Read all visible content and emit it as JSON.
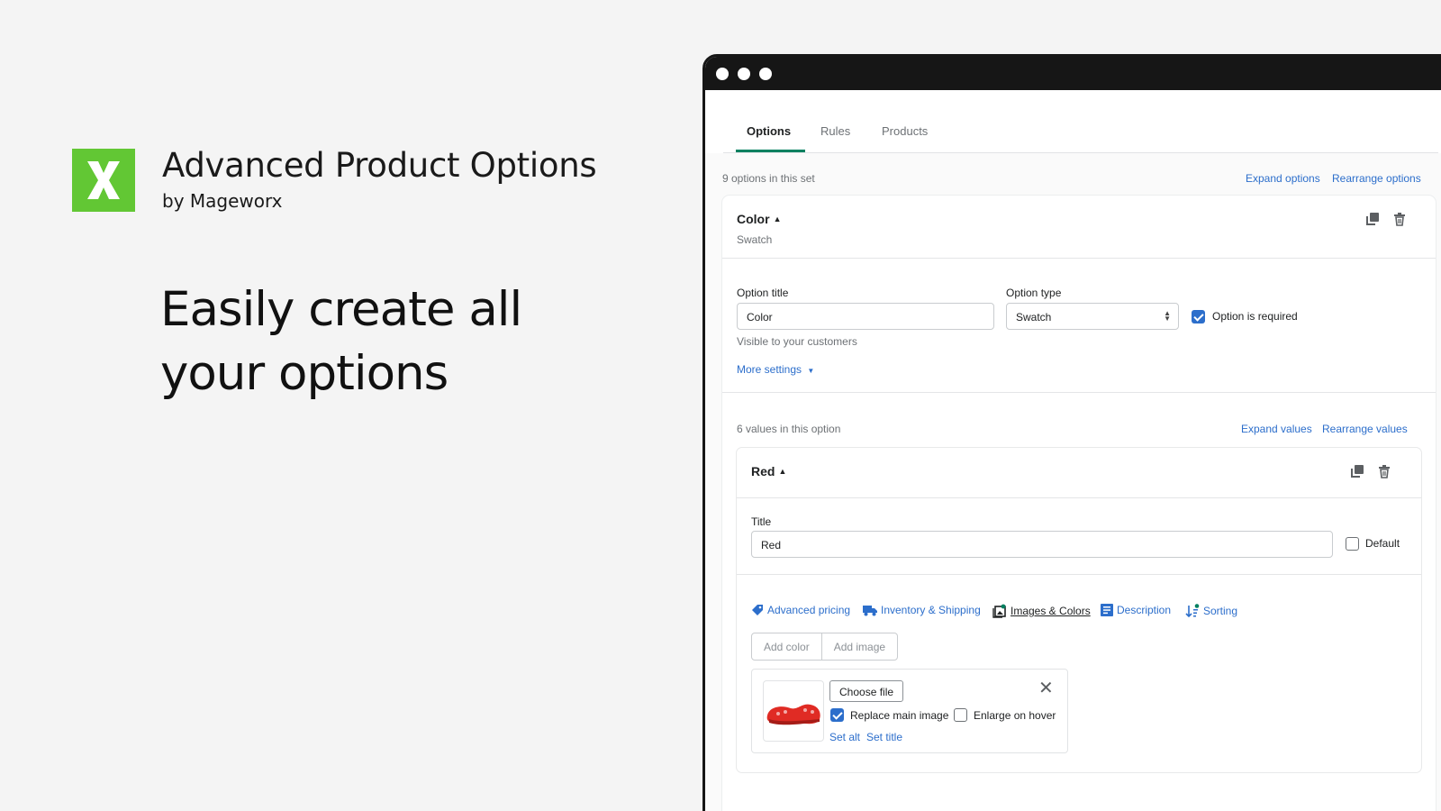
{
  "brand": {
    "title": "Advanced Product Options",
    "by": "by Mageworx",
    "headline": "Easily create all your options",
    "logo_color": "#62c734"
  },
  "tabs": [
    {
      "label": "Options",
      "active": true
    },
    {
      "label": "Rules",
      "active": false
    },
    {
      "label": "Products",
      "active": false
    }
  ],
  "options_meta": {
    "count_text": "9 options in this set",
    "expand": "Expand options",
    "rearrange": "Rearrange options"
  },
  "option": {
    "name": "Color",
    "subtitle": "Swatch",
    "title_label": "Option title",
    "title_value": "Color",
    "title_help": "Visible to your customers",
    "type_label": "Option type",
    "type_value": "Swatch",
    "required_label": "Option is required",
    "required": true,
    "more_settings": "More settings"
  },
  "values_meta": {
    "count_text": "6 values in this option",
    "expand": "Expand values",
    "rearrange": "Rearrange values"
  },
  "value": {
    "name": "Red",
    "title_label": "Title",
    "title_value": "Red",
    "default_label": "Default",
    "default": false
  },
  "subtabs": [
    {
      "label": "Advanced pricing",
      "icon": "tag-icon",
      "active": false
    },
    {
      "label": "Inventory & Shipping",
      "icon": "truck-icon",
      "active": false
    },
    {
      "label": "Images & Colors",
      "icon": "image-icon",
      "active": true
    },
    {
      "label": "Description",
      "icon": "document-icon",
      "active": false
    },
    {
      "label": "Sorting",
      "icon": "sort-icon",
      "active": false
    }
  ],
  "media_buttons": {
    "add_color": "Add color",
    "add_image": "Add image"
  },
  "image_item": {
    "choose_file": "Choose file",
    "replace_main_label": "Replace main image",
    "replace_main": true,
    "enlarge_label": "Enlarge on hover",
    "enlarge": false,
    "set_alt": "Set alt",
    "set_title": "Set title"
  },
  "colors": {
    "accent": "#2c6ecb",
    "tab_active": "#008060"
  }
}
